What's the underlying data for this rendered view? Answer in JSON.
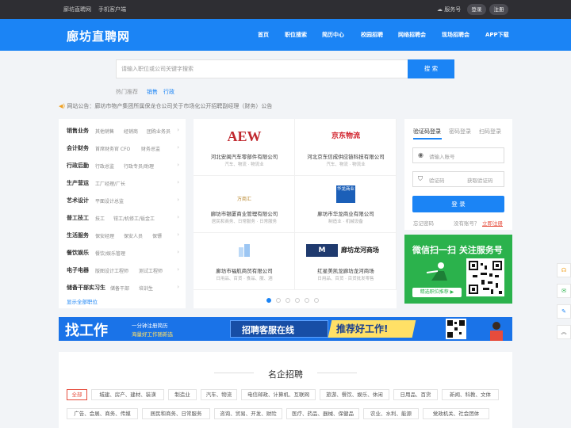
{
  "topbar": {
    "site": "廊坊直聘网",
    "mobile": "手机客户端",
    "service": "服务号",
    "login": "登录",
    "register": "注册"
  },
  "logo": "廊坊直聘网",
  "nav": [
    "首页",
    "职位搜索",
    "简历中心",
    "校园招聘",
    "网络招聘会",
    "现场招聘会",
    "APP下载"
  ],
  "search": {
    "placeholder": "请输入职位或公司关键字搜索",
    "button": "搜 索"
  },
  "hot": {
    "label": "热门推荐",
    "items": [
      "销售",
      "行政"
    ]
  },
  "notice": "网站公告：廊坊市物产集团所属保龙仓公司关于市场化公开招聘副经理（财务）公告",
  "categories": [
    {
      "title": "销售业务",
      "subs": [
        "其他销售",
        "经销商",
        "团购业务员"
      ]
    },
    {
      "title": "会计财务",
      "subs": [
        "首席财务官 CFO",
        "财务总监"
      ]
    },
    {
      "title": "行政后勤",
      "subs": [
        "行政总监",
        "行政专员/助理"
      ]
    },
    {
      "title": "生产营运",
      "subs": [
        "工厂经理/厂长"
      ]
    },
    {
      "title": "艺术设计",
      "subs": [
        "平面设计总监"
      ]
    },
    {
      "title": "普工技工",
      "subs": [
        "技工",
        "钳工/机修工/钣金工"
      ]
    },
    {
      "title": "生活服务",
      "subs": [
        "保安经理",
        "保安人员",
        "保镖"
      ]
    },
    {
      "title": "餐饮娱乐",
      "subs": [
        "餐饮/娱乐管理"
      ]
    },
    {
      "title": "电子电器",
      "subs": [
        "版图设计工程师",
        "测试工程师"
      ]
    },
    {
      "title": "储备干部实习生",
      "subs": [
        "储备干部",
        "培训生"
      ]
    }
  ],
  "all_categories": "显示全部职位",
  "companies": [
    {
      "name": "河北安闽汽车零部件有限公司",
      "desc": "汽车、物流 · 物流业",
      "logo": "AEW"
    },
    {
      "name": "河北京东信成供应链科技有限公司",
      "desc": "汽车、物流 · 物流业",
      "logo": "京东物流"
    },
    {
      "name": "廊坊市银厦商业管理有限公司",
      "desc": "居民和商务、日常服务 · 日常服务",
      "logo": "万商汇"
    },
    {
      "name": "廊坊市华龙商业有限公司",
      "desc": "制造业 · 机械设备",
      "logo": "华龙商业"
    },
    {
      "name": "廊坊市福航商贸有限公司",
      "desc": "日用品、百货 · 食品、服、酒",
      "logo": ""
    },
    {
      "name": "红星美凯龙廊坊龙河商场",
      "desc": "日用品、百货 · 百货批发零售",
      "logo": "廊坊龙河商场"
    }
  ],
  "login": {
    "tabs": [
      "验证码登录",
      "密码登录",
      "扫码登录"
    ],
    "account_placeholder": "请输入账号",
    "code_placeholder": "验证码",
    "get_code": "获取验证码",
    "button": "登 录",
    "forgot": "忘记密码",
    "no_account": "没有账号？",
    "register": "立即注册"
  },
  "wechat": {
    "title": "微信扫一扫 关注服务号",
    "button": "精选职位推荐 ▶"
  },
  "banner": {
    "left_big": "找工作",
    "left_small1": "一分钟注册简历",
    "left_small2": "海量好工作随新选",
    "middle": "招聘客服在线",
    "right": "推荐好工作!"
  },
  "section": {
    "title": "名企招聘",
    "tags": [
      "全部",
      "城建、房产、建材、装潢",
      "制造业",
      "汽车、物流",
      "电信邮政、计算机、互联网",
      "旅游、餐饮、娱乐、休闲",
      "日用品、百货",
      "新闻、科教、文体",
      "广告、会展、商务、传媒",
      "居民和商务、日常服务",
      "咨询、贸易、开发、财险",
      "医疗、药品、器械、保健品",
      "农业、水利、能源",
      "党政机关、社会团体"
    ]
  },
  "side": [
    "headset-icon",
    "wechat-icon",
    "chat-icon",
    "top-icon"
  ],
  "colors": {
    "brand": "#1b84f5",
    "topbar": "#2e2e33",
    "wechat": "#2bb24c",
    "accent": "#e64c3c"
  }
}
